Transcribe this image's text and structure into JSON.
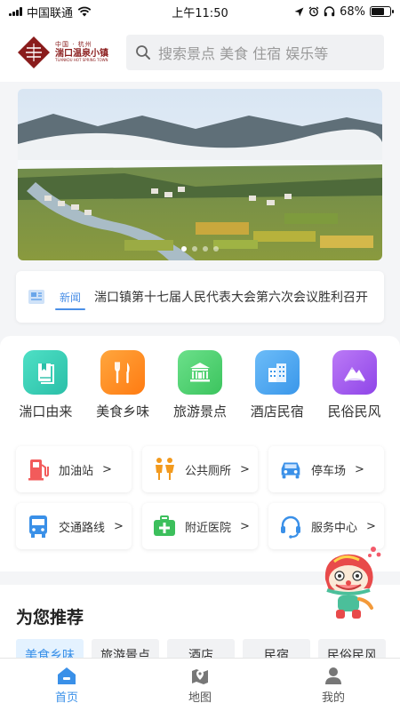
{
  "status_bar": {
    "carrier": "中国联通",
    "time": "上午11:50",
    "battery": "68%",
    "battery_level": 0.68
  },
  "header": {
    "logo": {
      "line_small": "中国 · 杭州",
      "line_main": "湍口温泉小镇",
      "line_en": "TUANKOU HOT SPRING TOWN"
    },
    "search_placeholder": "搜索景点 美食 住宿 娱乐等"
  },
  "banner": {
    "slide_count": 4,
    "active_index": 0
  },
  "news": {
    "tag": "新闻",
    "headline": "湍口镇第十七届人民代表大会第六次会议胜利召开"
  },
  "categories": [
    {
      "label": "湍口由来",
      "icon": "book-icon",
      "color": "#35d0b6"
    },
    {
      "label": "美食乡味",
      "icon": "cutlery-icon",
      "color": "#ff8a1e"
    },
    {
      "label": "旅游景点",
      "icon": "temple-icon",
      "color": "#4fcf6e"
    },
    {
      "label": "酒店民宿",
      "icon": "hotel-icon",
      "color": "#4aa6f2"
    },
    {
      "label": "民俗民风",
      "icon": "mountain-icon",
      "color": "#a35bf0"
    }
  ],
  "services": [
    {
      "label": "加油站",
      "icon": "gas-station-icon",
      "color": "#f25b5b"
    },
    {
      "label": "公共厕所",
      "icon": "restroom-icon",
      "color": "#f29a1e"
    },
    {
      "label": "停车场",
      "icon": "car-icon",
      "color": "#3a90e8"
    },
    {
      "label": "交通路线",
      "icon": "bus-icon",
      "color": "#3a90e8"
    },
    {
      "label": "附近医院",
      "icon": "first-aid-icon",
      "color": "#3cbf5c"
    },
    {
      "label": "服务中心",
      "icon": "headset-icon",
      "color": "#3a90e8"
    }
  ],
  "services_arrow": ">",
  "recommend": {
    "title": "为您推荐",
    "tabs": [
      "美食乡味",
      "旅游景点",
      "酒店",
      "民宿",
      "民俗民风"
    ],
    "active_tab": 0
  },
  "tabbar": [
    {
      "label": "首页",
      "icon": "home-icon"
    },
    {
      "label": "地图",
      "icon": "map-pin-icon"
    },
    {
      "label": "我的",
      "icon": "user-icon"
    }
  ],
  "colors": {
    "accent": "#3a90e8",
    "brand": "#8a1c1c"
  }
}
